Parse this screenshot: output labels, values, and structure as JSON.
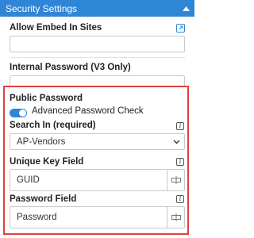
{
  "header": {
    "title": "Security Settings"
  },
  "allow_embed": {
    "label": "Allow Embed In Sites",
    "value": ""
  },
  "internal_password": {
    "label": "Internal Password (V3 Only)",
    "value": ""
  },
  "public_password": {
    "section_label": "Public Password",
    "toggle_label": "Advanced Password Check",
    "toggle_on": true
  },
  "search_in": {
    "label": "Search In (required)",
    "selected": "AP-Vendors"
  },
  "unique_key": {
    "label": "Unique Key Field",
    "value": "GUID"
  },
  "password_field": {
    "label": "Password Field",
    "value": "Password"
  },
  "colors": {
    "accent": "#2f86d6",
    "highlight_border": "#e04040"
  }
}
